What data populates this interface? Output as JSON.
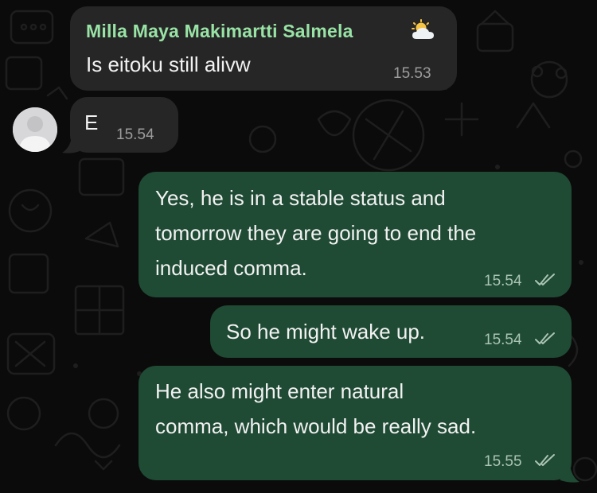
{
  "chat": {
    "messages": [
      {
        "direction": "incoming",
        "sender": "Milla Maya Makimartti Salmela",
        "sender_status_icon": "sun-behind-cloud-icon",
        "text": "Is eitoku still alivw",
        "time": "15.53"
      },
      {
        "direction": "incoming",
        "text": "E",
        "time": "15.54"
      },
      {
        "direction": "outgoing",
        "lines": [
          "Yes, he is in a stable status and",
          "tomorrow they are going to end the",
          "induced comma."
        ],
        "time": "15.54",
        "status_icon": "double-check-icon"
      },
      {
        "direction": "outgoing",
        "text": "So he might wake up.",
        "time": "15.54",
        "status_icon": "double-check-icon"
      },
      {
        "direction": "outgoing",
        "lines": [
          "He also might enter natural",
          "comma, which would be really sad."
        ],
        "time": "15.55",
        "status_icon": "double-check-icon"
      }
    ]
  },
  "colors": {
    "background": "#0b0b0b",
    "incoming_bubble": "#262626",
    "outgoing_bubble": "#1f4a34",
    "sender_name": "#98e3a5",
    "message_text": "#f2f2f2"
  }
}
